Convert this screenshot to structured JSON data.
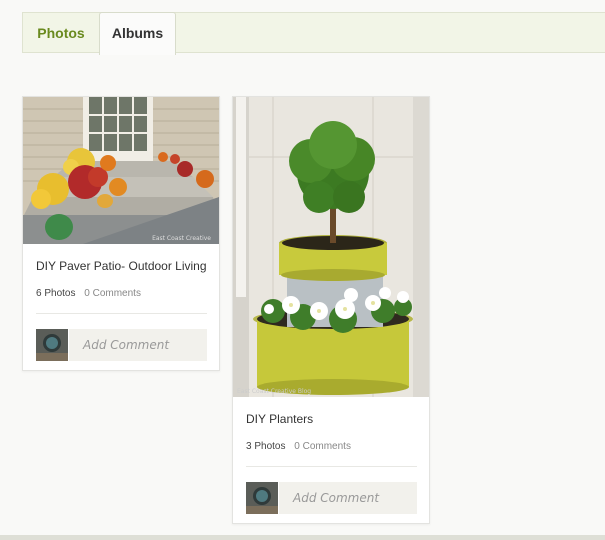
{
  "tabs": {
    "photos": "Photos",
    "albums": "Albums"
  },
  "albums": [
    {
      "title": "DIY Paver Patio- Outdoor Living",
      "photo_count": "6 Photos",
      "comments": "0 Comments",
      "comment_placeholder": "Add Comment"
    },
    {
      "title": "DIY Planters",
      "photo_count": "3 Photos",
      "comments": "0 Comments",
      "comment_placeholder": "Add Comment"
    }
  ],
  "colors": {
    "accent_green": "#6a8a1f",
    "tabbar_bg": "#f2f5e7",
    "planter_yellow": "#c8c83a"
  }
}
